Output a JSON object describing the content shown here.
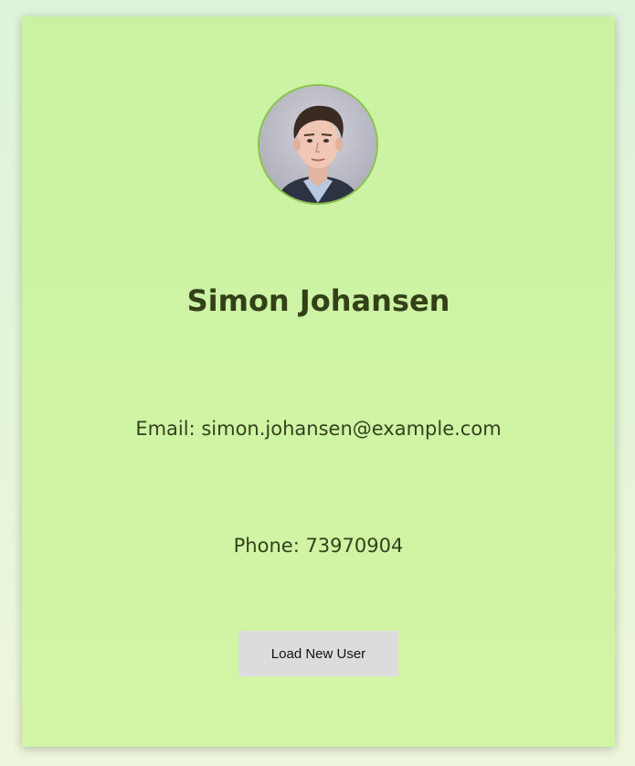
{
  "profile": {
    "avatar_icon": "user-photo",
    "name": "Simon Johansen",
    "email_line": "Email: simon.johansen@example.com",
    "phone_line": "Phone: 73970904"
  },
  "actions": {
    "load_label": "Load New User"
  },
  "colors": {
    "card_background": "#cdf3a4",
    "avatar_border": "#8bc34a",
    "name_text": "#334018",
    "button_background": "#dcdcdc"
  }
}
